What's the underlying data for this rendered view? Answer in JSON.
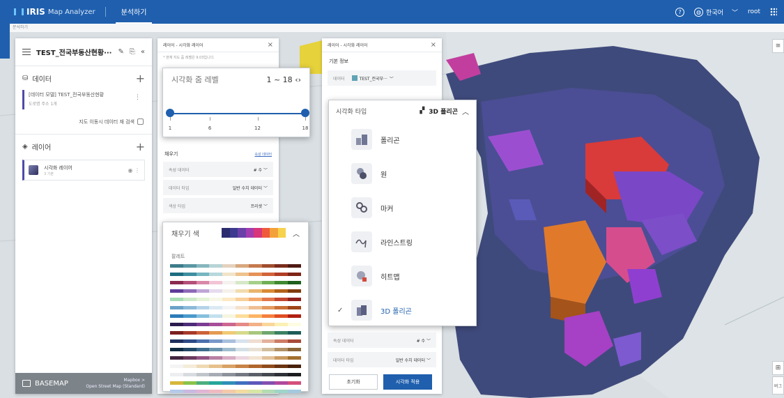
{
  "app": {
    "name": "Map Analyzer",
    "logo_text": "IRIS",
    "tab": "분석하기",
    "breadcrumb": "분석하기",
    "language": "한국어",
    "user": "root",
    "help_icon": "question-circle-icon",
    "globe_icon": "globe-icon",
    "apps_icon": "grid-dots-icon"
  },
  "left_panel": {
    "title": "TEST_전국부동산현황···",
    "data_section": {
      "label": "데이터",
      "item_title": "[데이터 모델] TEST_전국부동산현황",
      "item_sub": "도로명 주소 1개"
    },
    "search_on_move": "지도 이동시 데이터 재 검색",
    "layer_section": {
      "label": "레이어",
      "layer_name": "시각화 레이어",
      "layer_sub": "3 기본"
    },
    "basemap": {
      "label": "BASEMAP",
      "provider": "Mapbox >",
      "style": "Open Street Map (Standard)"
    }
  },
  "middle_panel": {
    "title": "레이어 - 시각화 레이어",
    "note": "* 현재 지도 줌 레벨은 9.03입니다.",
    "fill_label": "채우기",
    "fill_link": "속성 데이터",
    "rows": [
      {
        "label": "속성 데이터",
        "value": "# 수"
      },
      {
        "label": "데이터 타입",
        "value": "일반 수치 데이터"
      },
      {
        "label": "색상 타입",
        "value": "프리셋"
      }
    ]
  },
  "zoom_card": {
    "label": "시각화 줌 레벨",
    "range": "1 ~ 18",
    "min": 1,
    "max": 18,
    "low": 1,
    "high": 18,
    "ticks": [
      "1",
      "6",
      "12",
      "18"
    ]
  },
  "palette_card": {
    "label": "채우기 색",
    "palette_label": "팔레트",
    "current": [
      "#2b2c6e",
      "#3d3a8f",
      "#6b3fa8",
      "#a33cb0",
      "#d8357a",
      "#ef5a3c",
      "#f3a23a",
      "#f6d24d"
    ],
    "palettes": [
      [
        "#3e7b8a",
        "#5b97a3",
        "#86b6bd",
        "#b8d4d6",
        "#e4d2bf",
        "#d8a77f",
        "#c57a4f",
        "#a04d2f",
        "#7a2c1d",
        "#4e1a12"
      ],
      [
        "#1c6d80",
        "#3e8fa0",
        "#76b6c0",
        "#b7d8dc",
        "#f2e4c9",
        "#eec28e",
        "#e59258",
        "#d2633a",
        "#b13d25",
        "#7e2417"
      ],
      [
        "#8a2a4f",
        "#b4507a",
        "#d987a8",
        "#f2c4d6",
        "#f4f1ee",
        "#d6e8c8",
        "#a5d08a",
        "#6faf53",
        "#3f8a31",
        "#1d5f1c"
      ],
      [
        "#5e3c99",
        "#8e6ab8",
        "#bfa6d6",
        "#e6dbef",
        "#f5f1ea",
        "#f2dcae",
        "#e9b56b",
        "#d88a34",
        "#b2611a",
        "#7f3c0c"
      ],
      [
        "#a8ddb5",
        "#cdeac8",
        "#e4f3d6",
        "#f6f7e6",
        "#fde9c5",
        "#f9d09b",
        "#f4aa6f",
        "#e2774b",
        "#c3462f",
        "#8f211a"
      ],
      [
        "#6aa2c8",
        "#8cbad8",
        "#b4d3e8",
        "#dbe9f4",
        "#f4f4f4",
        "#f6e1ca",
        "#efbf92",
        "#e39a60",
        "#cb6f36",
        "#9f4519"
      ],
      [
        "#2c7bb6",
        "#4a9acc",
        "#87bfde",
        "#c4e0ed",
        "#f6f6df",
        "#fddd9a",
        "#fcb465",
        "#f5803e",
        "#df4e23",
        "#b01f11"
      ],
      [
        "#2b1b4f",
        "#4d2b79",
        "#7a3d93",
        "#a64f99",
        "#cc6790",
        "#e58a86",
        "#f2b186",
        "#f9d79a",
        "#fbf0b5",
        "#fefce0"
      ],
      [
        "#7a1f1f",
        "#a73a2b",
        "#cd6239",
        "#e49b52",
        "#efca76",
        "#d7da8a",
        "#a8c77d",
        "#6fa670",
        "#3c8264",
        "#1d5c57"
      ],
      [
        "#1d2f5c",
        "#2d4a86",
        "#4c6fad",
        "#7897c8",
        "#a9bfdd",
        "#d8e2ef",
        "#f0ddd0",
        "#e2b19b",
        "#cd7c66",
        "#a84b3a"
      ],
      [
        "#0f2a3f",
        "#224766",
        "#3d6b8c",
        "#6a93ad",
        "#a1bcce",
        "#d4e0e6",
        "#e9e1d3",
        "#d2bd9c",
        "#b29167",
        "#8a6638"
      ],
      [
        "#43253f",
        "#6a3a5e",
        "#935482",
        "#b97fa3",
        "#d8adc4",
        "#ecd6df",
        "#f2e4d1",
        "#e2c19a",
        "#c99a62",
        "#a3702f"
      ],
      [
        "#f4f4f4",
        "#f4ecd9",
        "#efd9b4",
        "#e6c08b",
        "#d9a266",
        "#c88346",
        "#b0662d",
        "#8f4b1c",
        "#6b3412",
        "#48210b"
      ],
      [
        "#eceef0",
        "#d8dbe0",
        "#c0c4cb",
        "#a6abb4",
        "#8c919b",
        "#737881",
        "#5b6068",
        "#44484f",
        "#2e3137",
        "#1a1c20"
      ],
      [
        "#d6b73a",
        "#8bc34a",
        "#4caf7d",
        "#26a69a",
        "#2f8fb8",
        "#3f6fc0",
        "#5c58bb",
        "#8250b0",
        "#b04a9c",
        "#d4507a"
      ],
      [
        "#b5c9e8",
        "#c9b9e0",
        "#e0b5d3",
        "#f0b9c0",
        "#f5c9a8",
        "#f2dc9e",
        "#d8e6a4",
        "#b3dcb2",
        "#9fd5c9",
        "#a4c9df"
      ]
    ]
  },
  "right_panel": {
    "title": "레이어 - 시각화 레이어",
    "info_label": "기본 정보",
    "data_label": "데이터",
    "data_value": "TEST_전국부···",
    "rows": [
      {
        "label": "속성 데이터",
        "value": "# 수"
      },
      {
        "label": "데이터 타입",
        "value": "일반 수치 데이터"
      }
    ],
    "reset_button": "초기화",
    "apply_button": "시각화 적용"
  },
  "type_card": {
    "label": "시각화 타입",
    "selected": "3D 폴리곤",
    "options": [
      {
        "name": "폴리곤",
        "icon": "polygon-icon"
      },
      {
        "name": "원",
        "icon": "circle-icon"
      },
      {
        "name": "마커",
        "icon": "marker-icon"
      },
      {
        "name": "라인스트링",
        "icon": "linestring-icon"
      },
      {
        "name": "히트맵",
        "icon": "heatmap-icon"
      },
      {
        "name": "3D 폴리곤",
        "icon": "3d-polygon-icon"
      }
    ]
  },
  "map_controls": {
    "legend_label": "버그"
  }
}
